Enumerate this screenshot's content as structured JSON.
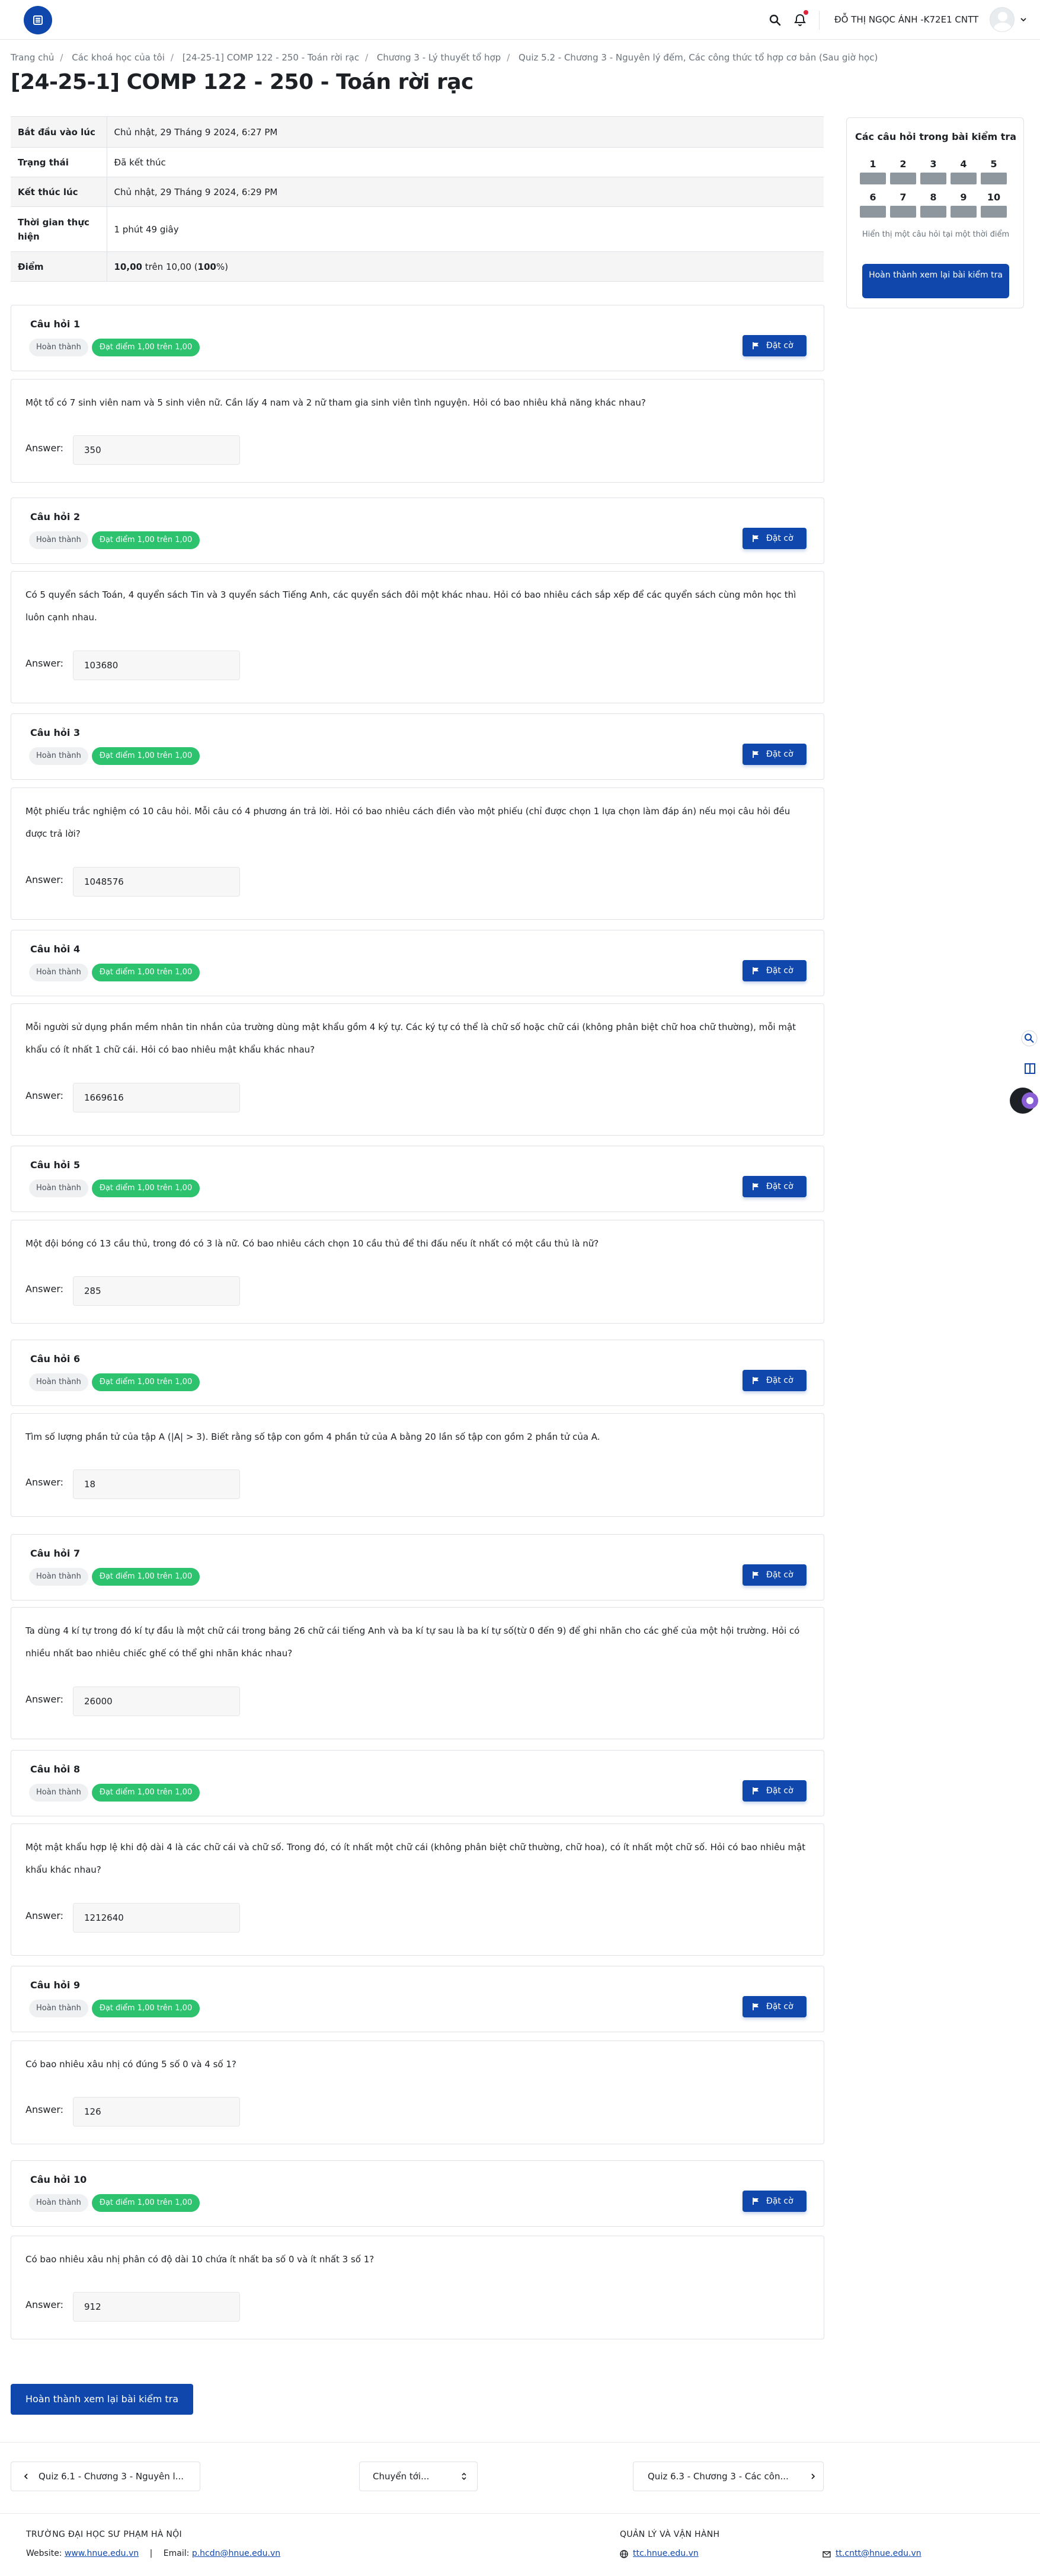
{
  "header": {
    "user_name": "ĐỖ THỊ NGỌC ÁNH -K72E1 CNTT",
    "colors": {
      "primary": "#0f47ad",
      "notification": "#e0243a"
    },
    "icons": [
      "menu-icon",
      "search-icon",
      "bell-icon",
      "chevron-down-icon"
    ]
  },
  "breadcrumb": [
    "Trang chủ",
    "Các khoá học của tôi",
    "[24-25-1] COMP 122 - 250 - Toán rời rạc",
    "Chương 3 - Lý thuyết tổ hợp",
    "Quiz 5.2 - Chương 3 - Nguyên lý đếm, Các công thức tổ hợp cơ bản (Sau giờ học)"
  ],
  "page_title": "[24-25-1] COMP 122 - 250 - Toán rời rạc",
  "summary": {
    "rows": [
      {
        "label": "Bắt đầu vào lúc",
        "value": "Chủ nhật, 29 Tháng 9 2024, 6:27 PM"
      },
      {
        "label": "Trạng thái",
        "value": "Đã kết thúc"
      },
      {
        "label": "Kết thúc lúc",
        "value": "Chủ nhật, 29 Tháng 9 2024, 6:29 PM"
      },
      {
        "label": "Thời gian thực hiện",
        "value": "1 phút 49 giây"
      }
    ],
    "grade_label": "Điểm",
    "grade_score": "10,00",
    "grade_mid": "trên 10,00 (",
    "grade_percent": "100",
    "grade_end": "%)"
  },
  "quiz_nav": {
    "title": "Các câu hỏi trong bài kiểm tra",
    "buttons": [
      "1",
      "2",
      "3",
      "4",
      "5",
      "6",
      "7",
      "8",
      "9",
      "10"
    ],
    "show_one": "Hiển thị một câu hỏi tại một thời điểm",
    "finish": "Hoàn thành xem lại bài kiểm tra"
  },
  "question_common": {
    "state": "Hoàn thành",
    "grade": "Đạt điểm 1,00 trên 1,00",
    "flag": "Đặt cờ",
    "answer_label": "Answer:"
  },
  "questions": [
    {
      "title": "Câu hỏi 1",
      "text": "Một tổ có 7 sinh viên nam và 5 sinh viên nữ. Cần lấy 4 nam và 2 nữ tham gia sinh viên tình nguyện. Hỏi có bao nhiêu khả năng khác nhau?",
      "answer": "350"
    },
    {
      "title": "Câu hỏi 2",
      "text": "Có 5 quyển sách Toán, 4 quyển sách Tin và 3 quyển sách Tiếng Anh, các quyển sách đôi một khác nhau. Hỏi có bao nhiêu cách sắp xếp để các quyển sách cùng môn học thì luôn cạnh nhau.",
      "answer": "103680"
    },
    {
      "title": "Câu hỏi 3",
      "text": "Một phiếu trắc nghiệm có 10 câu hỏi. Mỗi câu có 4 phương án trả lời. Hỏi có bao nhiêu cách điền vào một phiếu (chỉ được chọn 1 lựa chọn làm đáp án) nếu mọi câu hỏi đều được trả lời?",
      "answer": "1048576"
    },
    {
      "title": "Câu hỏi 4",
      "text": "Mỗi người sử dụng phần mềm nhân tin nhắn của trường dùng mật khẩu gồm 4 ký tự. Các ký tự có thể là chữ số hoặc chữ cái (không phân biệt chữ hoa chữ thường), mỗi mật khẩu có ít nhất 1 chữ cái. Hỏi có bao nhiêu mật khẩu khác nhau?",
      "answer": "1669616"
    },
    {
      "title": "Câu hỏi 5",
      "text": "Một đội bóng có 13 cầu thủ, trong đó có 3 là nữ. Có bao nhiêu cách chọn 10 cầu thủ để thi đấu nếu ít nhất có một cầu thủ là nữ?",
      "answer": "285"
    },
    {
      "title": "Câu hỏi 6",
      "text": "Tìm số lượng phần tử của tập A (|A| > 3). Biết rằng số tập con gồm 4 phần tử của A bằng 20 lần số tập con gồm 2 phần tử của A.",
      "answer": "18"
    },
    {
      "title": "Câu hỏi 7",
      "text": "Ta dùng 4 kí tự trong đó kí tự đầu là một chữ cái trong bảng 26 chữ cái tiếng Anh và ba kí tự sau là ba kí tự số(từ 0 đến 9) để ghi nhãn cho các ghế của một hội trường. Hỏi có nhiều nhất bao nhiêu chiếc ghế có thể ghi nhãn khác nhau?",
      "answer": "26000"
    },
    {
      "title": "Câu hỏi 8",
      "text": "Một mật khẩu hợp lệ khi độ dài 4 là các chữ cái và chữ số. Trong đó, có ít nhất một chữ cái (không phân biệt chữ thường, chữ hoa), có ít nhất một chữ số. Hỏi có bao nhiêu mật khẩu khác nhau?",
      "answer": "1212640"
    },
    {
      "title": "Câu hỏi 9",
      "text": "Có bao nhiêu xâu nhị có đúng 5 số 0 và 4 số 1?",
      "answer": "126"
    },
    {
      "title": "Câu hỏi 10",
      "text": "Có bao nhiêu xâu nhị phân có độ dài 10 chứa ít nhất ba số 0 và ít nhất 3 số 1?",
      "answer": "912"
    }
  ],
  "finish_review": "Hoàn thành xem lại bài kiểm tra",
  "activity_nav": {
    "prev": "Quiz 6.1 - Chương 3 - Nguyên l...",
    "jump": "Chuyển tới...",
    "next": "Quiz 6.3 - Chương 3 - Các côn..."
  },
  "footer": {
    "org": "TRƯỜNG ĐẠI HỌC SƯ PHẠM HÀ NỘI",
    "website_label": "Website:",
    "website": "www.hnue.edu.vn",
    "sep": "|",
    "email_label": "Email:",
    "email": "p.hcdn@hnue.edu.vn",
    "admin_title": "QUẢN LÝ VÀ VẬN HÀNH",
    "admin_site": "ttc.hnue.edu.vn",
    "admin_email": "tt.cntt@hnue.edu.vn"
  }
}
